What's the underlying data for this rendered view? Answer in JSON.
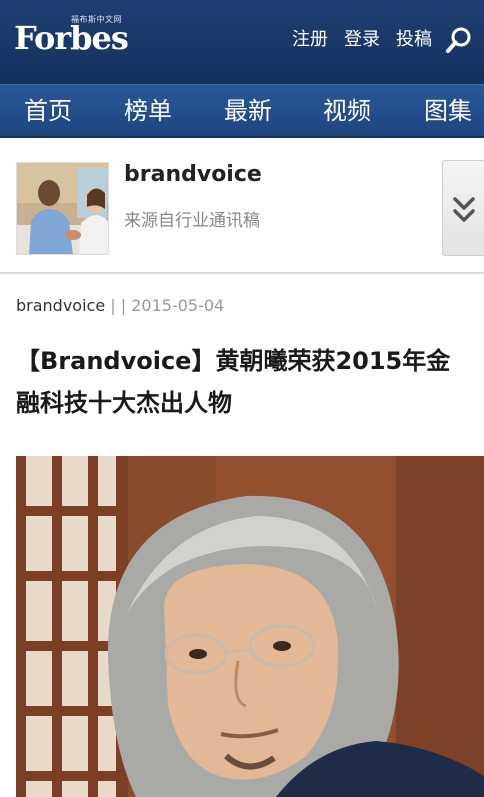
{
  "header": {
    "logo_text": "Forbes",
    "logo_sub": "福布斯中文网",
    "links": [
      "注册",
      "登录",
      "投稿"
    ],
    "search_icon": "search-icon"
  },
  "nav": {
    "items": [
      "首页",
      "榜单",
      "最新",
      "视频",
      "图集"
    ]
  },
  "author_card": {
    "name": "brandvoice",
    "description": "来源自行业通讯稿",
    "expand_icon": "double-chevron-down-icon"
  },
  "article": {
    "meta_author": "brandvoice",
    "meta_separator": " | | ",
    "meta_date": "2015-05-04",
    "title": "【Brandvoice】黄朝曦荣获2015年金融科技十大杰出人物"
  },
  "colors": {
    "header_bg": "#1f3f73",
    "nav_bg": "#2a5798",
    "text_muted": "#888888"
  }
}
